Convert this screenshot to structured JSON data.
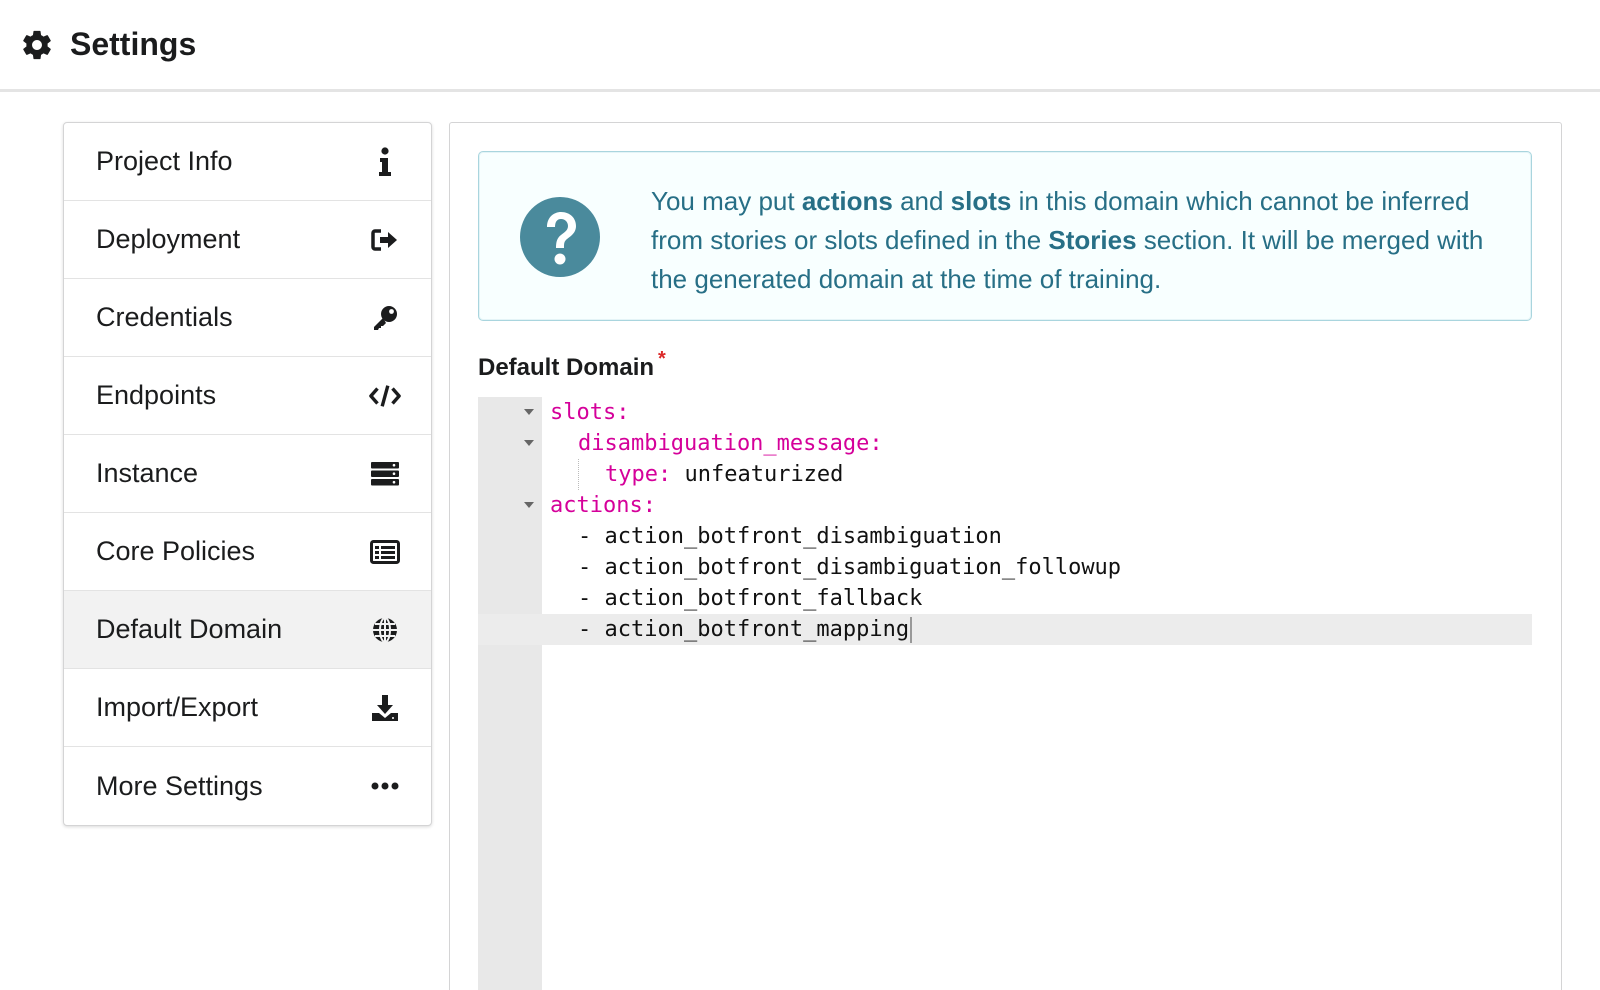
{
  "header": {
    "title": "Settings",
    "icon": "gear-icon"
  },
  "menu": {
    "items": [
      {
        "label": "Project Info",
        "icon": "info-icon"
      },
      {
        "label": "Deployment",
        "icon": "sign-out-icon"
      },
      {
        "label": "Credentials",
        "icon": "key-icon"
      },
      {
        "label": "Endpoints",
        "icon": "code-icon"
      },
      {
        "label": "Instance",
        "icon": "server-icon"
      },
      {
        "label": "Core Policies",
        "icon": "list-alternate-icon"
      },
      {
        "label": "Default Domain",
        "icon": "globe-icon"
      },
      {
        "label": "Import/Export",
        "icon": "download-icon"
      },
      {
        "label": "More Settings",
        "icon": "ellipsis-icon"
      }
    ],
    "active": "Default Domain"
  },
  "info": {
    "p1": "You may put ",
    "b1": "actions",
    "p2": " and ",
    "b2": "slots",
    "p3": " in this domain which cannot be inferred from stories or slots defined in the ",
    "b3": "Stories",
    "p4": " section. It will be merged with the generated domain at the time of training."
  },
  "field": {
    "label": "Default Domain",
    "required_mark": "*"
  },
  "editor": {
    "lines": [
      {
        "key": "slots:",
        "value": ""
      },
      {
        "key": "disambiguation_message:",
        "value": ""
      },
      {
        "key": "type:",
        "value": " unfeaturized"
      },
      {
        "key": "actions:",
        "value": ""
      },
      {
        "key": "",
        "value": "- action_botfront_disambiguation"
      },
      {
        "key": "",
        "value": "- action_botfront_disambiguation_followup"
      },
      {
        "key": "",
        "value": "- action_botfront_fallback"
      },
      {
        "key": "",
        "value": "- action_botfront_mapping"
      }
    ]
  },
  "colors": {
    "accent_text": "#276f86",
    "info_bg": "#f8ffff",
    "yaml_key": "#d5009a",
    "required": "#db2828"
  }
}
